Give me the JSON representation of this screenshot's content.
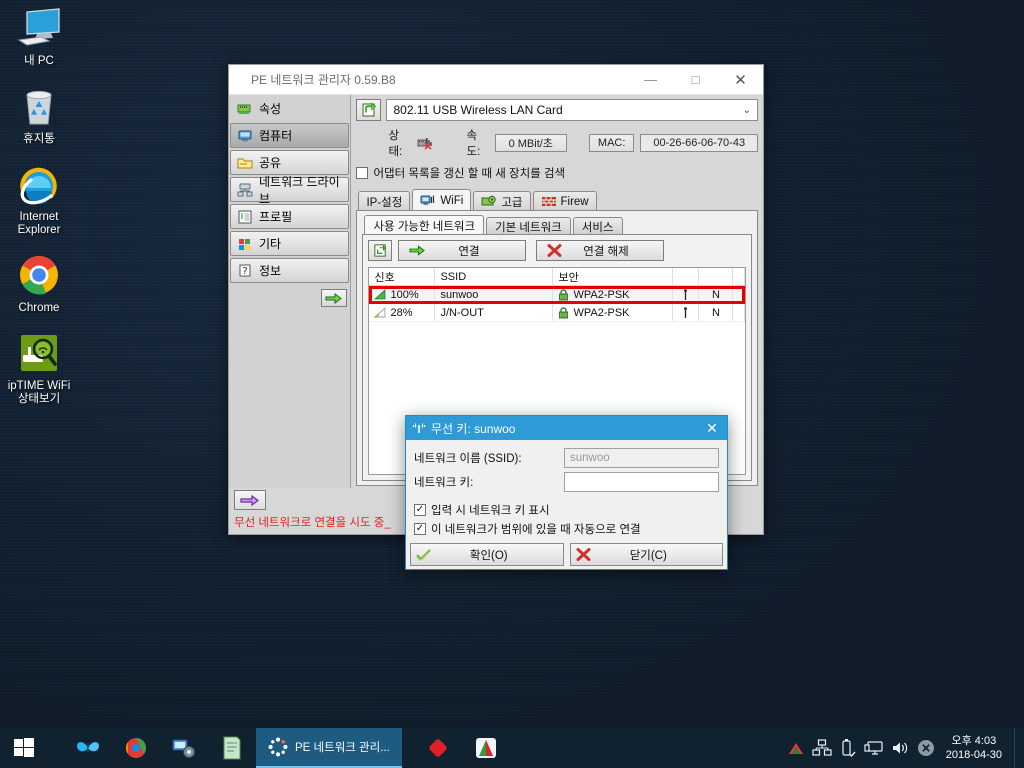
{
  "desktop": {
    "icons": [
      {
        "name": "my-pc",
        "label": "내 PC",
        "icon": "monitor-icon"
      },
      {
        "name": "recycle-bin",
        "label": "휴지통",
        "icon": "recycle-bin-icon"
      },
      {
        "name": "internet-explorer",
        "label": "Internet\nExplorer",
        "icon": "internet-explorer-icon"
      },
      {
        "name": "chrome",
        "label": "Chrome",
        "icon": "chrome-icon"
      },
      {
        "name": "iptime-wifi",
        "label": "ipTIME WiFi\n상태보기",
        "icon": "wifi-magnifier-icon"
      }
    ]
  },
  "window": {
    "title": "PE 네트워크 관리자 0.59.B8",
    "minimize_label": "—",
    "maximize_label": "□",
    "close_label": "✕",
    "sidebar": [
      {
        "label": "속성",
        "icon": "network-card-icon"
      },
      {
        "label": "컴퓨터",
        "icon": "computer-icon"
      },
      {
        "label": "공유",
        "icon": "share-folder-icon"
      },
      {
        "label": "네트워크 드라이브",
        "icon": "network-drive-icon"
      },
      {
        "label": "프로필",
        "icon": "profile-list-icon"
      },
      {
        "label": "기타",
        "icon": "misc-squares-icon"
      },
      {
        "label": "정보",
        "icon": "info-question-icon"
      }
    ],
    "sidebar_go_icon": "green-arrow-right-icon",
    "adapter": {
      "refresh_icon": "refresh-adapter-icon",
      "selected": "802.11 USB Wireless LAN Card",
      "caret": "⌄"
    },
    "status": {
      "state_label": "상태:",
      "state_icon": "disconnected-network-icon",
      "speed_label": "속도:",
      "speed_value": "0 MBit/초",
      "mac_label": "MAC:",
      "mac_value": "00-26-66-06-70-43"
    },
    "scan_checkbox": {
      "label": "어댑터 목록을 갱신 할 때 새 장치를 검색",
      "checked": false
    },
    "main_tabs": [
      {
        "label": "IP-설정",
        "icon": "",
        "active": false
      },
      {
        "label": "WiFi",
        "icon": "wifi-monitor-icon",
        "active": true
      },
      {
        "label": "고급",
        "icon": "advanced-gear-icon",
        "active": false
      },
      {
        "label": "Firew",
        "icon": "firewall-brick-icon",
        "active": false
      }
    ],
    "sub_tabs": [
      {
        "label": "사용 가능한 네트워크",
        "active": true
      },
      {
        "label": "기본 네트워크",
        "active": false
      },
      {
        "label": "서비스",
        "active": false
      }
    ],
    "toolbar": {
      "refresh_icon": "refresh-list-icon",
      "connect_label": "연결",
      "connect_icon": "green-arrow-right-icon",
      "disconnect_label": "연결 해제",
      "disconnect_icon": "red-x-icon"
    },
    "network_table": {
      "headers": [
        "신호",
        "SSID",
        "보안",
        "",
        "",
        ""
      ],
      "rows": [
        {
          "signal": "100%",
          "ssid": "sunwoo",
          "security": "WPA2-PSK",
          "col4": "",
          "col5": "N",
          "highlighted": true,
          "signal_icon": "signal-full-icon",
          "lock_icon": "lock-green-icon",
          "antenna_icon": "antenna-icon"
        },
        {
          "signal": "28%",
          "ssid": "J/N-OUT",
          "security": "WPA2-PSK",
          "col4": "",
          "col5": "N",
          "highlighted": false,
          "signal_icon": "signal-weak-icon",
          "lock_icon": "lock-green-icon",
          "antenna_icon": "antenna-icon"
        }
      ]
    },
    "footer": {
      "arrow_icon": "purple-arrow-right-icon",
      "status_text": "무선 네트워크로 연결을 시도 중_"
    }
  },
  "dialog": {
    "title": "무선 키: sunwoo",
    "title_icon": "wifi-signal-icon",
    "close_label": "✕",
    "ssid_label": "네트워크 이름 (SSID):",
    "ssid_value": "sunwoo",
    "key_label": "네트워크 키:",
    "key_value": "",
    "key_placeholder": "",
    "show_key_checkbox": {
      "label": "입력 시 네트워크 키 표시",
      "checked": true
    },
    "auto_connect_checkbox": {
      "label": "이 네트워크가 범위에 있을 때 자동으로 연결",
      "checked": true
    },
    "ok_label": "확인(O)",
    "ok_icon": "green-check-icon",
    "cancel_label": "닫기(C)",
    "cancel_icon": "red-x-icon"
  },
  "taskbar": {
    "start_icon": "windows-start-icon",
    "pinned": [
      {
        "name": "butterfly-app",
        "icon": "butterfly-icon"
      },
      {
        "name": "parrot-app",
        "icon": "parrot-icon"
      },
      {
        "name": "settings-app",
        "icon": "settings-gear-icon"
      },
      {
        "name": "notes-app",
        "icon": "notes-icon"
      }
    ],
    "active_task": {
      "label": "PE 네트워크 관리...",
      "icon": "loading-dots-icon"
    },
    "right_pinned": [
      {
        "name": "red-diamond-app",
        "icon": "red-diamond-icon"
      },
      {
        "name": "green-red-app",
        "icon": "green-red-icon"
      }
    ],
    "tray": [
      {
        "name": "tray-red-triangle",
        "icon": "red-triangle-icon"
      },
      {
        "name": "tray-network",
        "icon": "network-icon"
      },
      {
        "name": "tray-usb",
        "icon": "usb-eject-icon"
      },
      {
        "name": "tray-display",
        "icon": "display-icon"
      },
      {
        "name": "tray-volume",
        "icon": "volume-icon"
      },
      {
        "name": "tray-close",
        "icon": "gray-close-icon"
      }
    ],
    "clock": {
      "time": "오후 4:03",
      "date": "2018-04-30"
    }
  },
  "colors": {
    "accent_blue": "#2e9bd6",
    "taskbar": "#10222f",
    "active_task": "#1d5b80",
    "highlight_red": "#e60000",
    "status_red": "#e02020"
  }
}
